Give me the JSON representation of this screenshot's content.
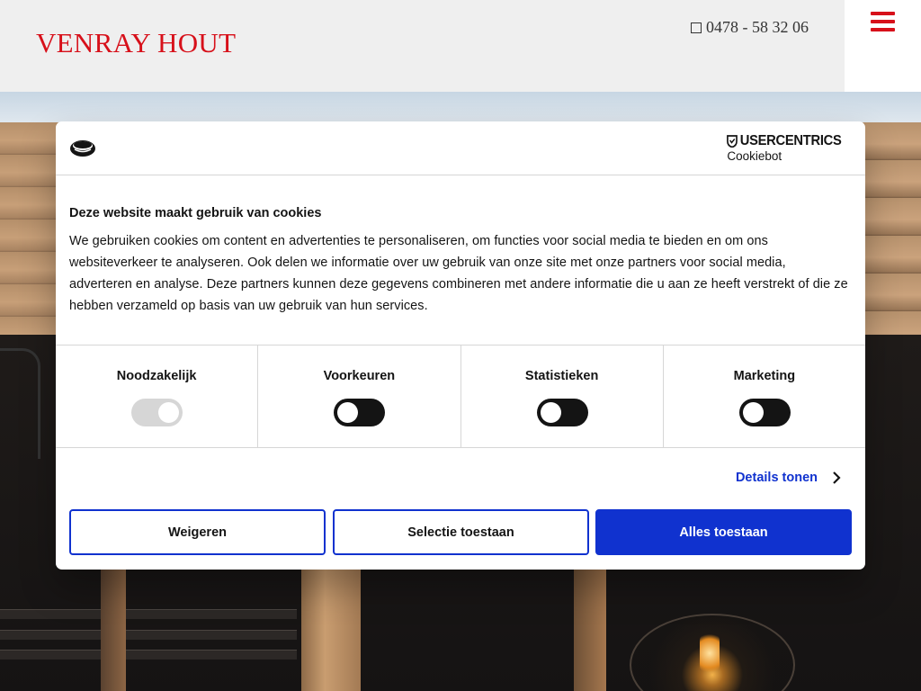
{
  "header": {
    "logo_text": "VENRAY HOUT",
    "phone": "0478 - 58 32 06",
    "menu_icon": "hamburger-icon",
    "brand_color": "#d7101a"
  },
  "cookie_dialog": {
    "provider_name": "USERCENTRICS",
    "provider_sub": "Cookiebot",
    "heading": "Deze website maakt gebruik van cookies",
    "body": "We gebruiken cookies om content en advertenties te personaliseren, om functies voor social media te bieden en om ons websiteverkeer te analyseren. Ook delen we informatie over uw gebruik van onze site met onze partners voor social media, adverteren en analyse. Deze partners kunnen deze gegevens combineren met andere informatie die u aan ze heeft verstrekt of die ze hebben verzameld op basis van uw gebruik van hun services.",
    "categories": [
      {
        "label": "Noodzakelijk",
        "enabled": true,
        "disabled": true
      },
      {
        "label": "Voorkeuren",
        "enabled": false,
        "disabled": false
      },
      {
        "label": "Statistieken",
        "enabled": false,
        "disabled": false
      },
      {
        "label": "Marketing",
        "enabled": false,
        "disabled": false
      }
    ],
    "details_link": "Details tonen",
    "buttons": {
      "deny": "Weigeren",
      "allow_selection": "Selectie toestaan",
      "allow_all": "Alles toestaan"
    },
    "accent_color": "#1032cf"
  }
}
